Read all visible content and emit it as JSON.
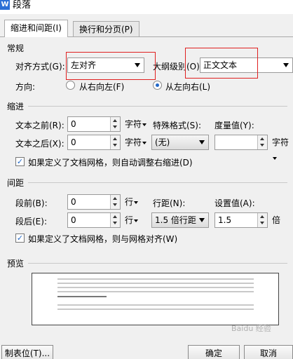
{
  "window": {
    "title": "段落",
    "icon_glyph": "W"
  },
  "tabs": [
    {
      "label": "缩进和间距(I)",
      "active": true
    },
    {
      "label": "换行和分页(P)",
      "active": false
    }
  ],
  "general": {
    "heading": "常规",
    "alignment_label": "对齐方式(G):",
    "alignment_value": "左对齐",
    "outline_label": "大纲级别(O):",
    "outline_value": "正文文本",
    "direction_label": "方向:",
    "rtl_label": "从右向左(F)",
    "ltr_label": "从左向右(L)",
    "direction_selected": "ltr"
  },
  "indent": {
    "heading": "缩进",
    "before_label": "文本之前(R):",
    "before_value": "0",
    "before_unit": "字符",
    "after_label": "文本之后(X):",
    "after_value": "0",
    "after_unit": "字符",
    "special_label": "特殊格式(S):",
    "special_value": "(无)",
    "measure_label": "度量值(Y):",
    "measure_value": "",
    "measure_unit": "字符",
    "grid_checkbox_label": "如果定义了文档网格，则自动调整右缩进(D)",
    "grid_checked": true
  },
  "spacing": {
    "heading": "间距",
    "before_label": "段前(B):",
    "before_value": "0",
    "before_unit": "行",
    "after_label": "段后(E):",
    "after_value": "0",
    "after_unit": "行",
    "line_label": "行距(N):",
    "line_value": "1.5 倍行距",
    "setting_label": "设置值(A):",
    "setting_value": "1.5",
    "setting_unit": "倍",
    "grid_checkbox_label": "如果定义了文档网格，则与网格对齐(W)",
    "grid_checked": true
  },
  "preview": {
    "heading": "预览"
  },
  "footer": {
    "tabs_button": "制表位(T)...",
    "ok_button": "确定",
    "cancel_button": "取消"
  },
  "watermark": "Baidu 经验"
}
